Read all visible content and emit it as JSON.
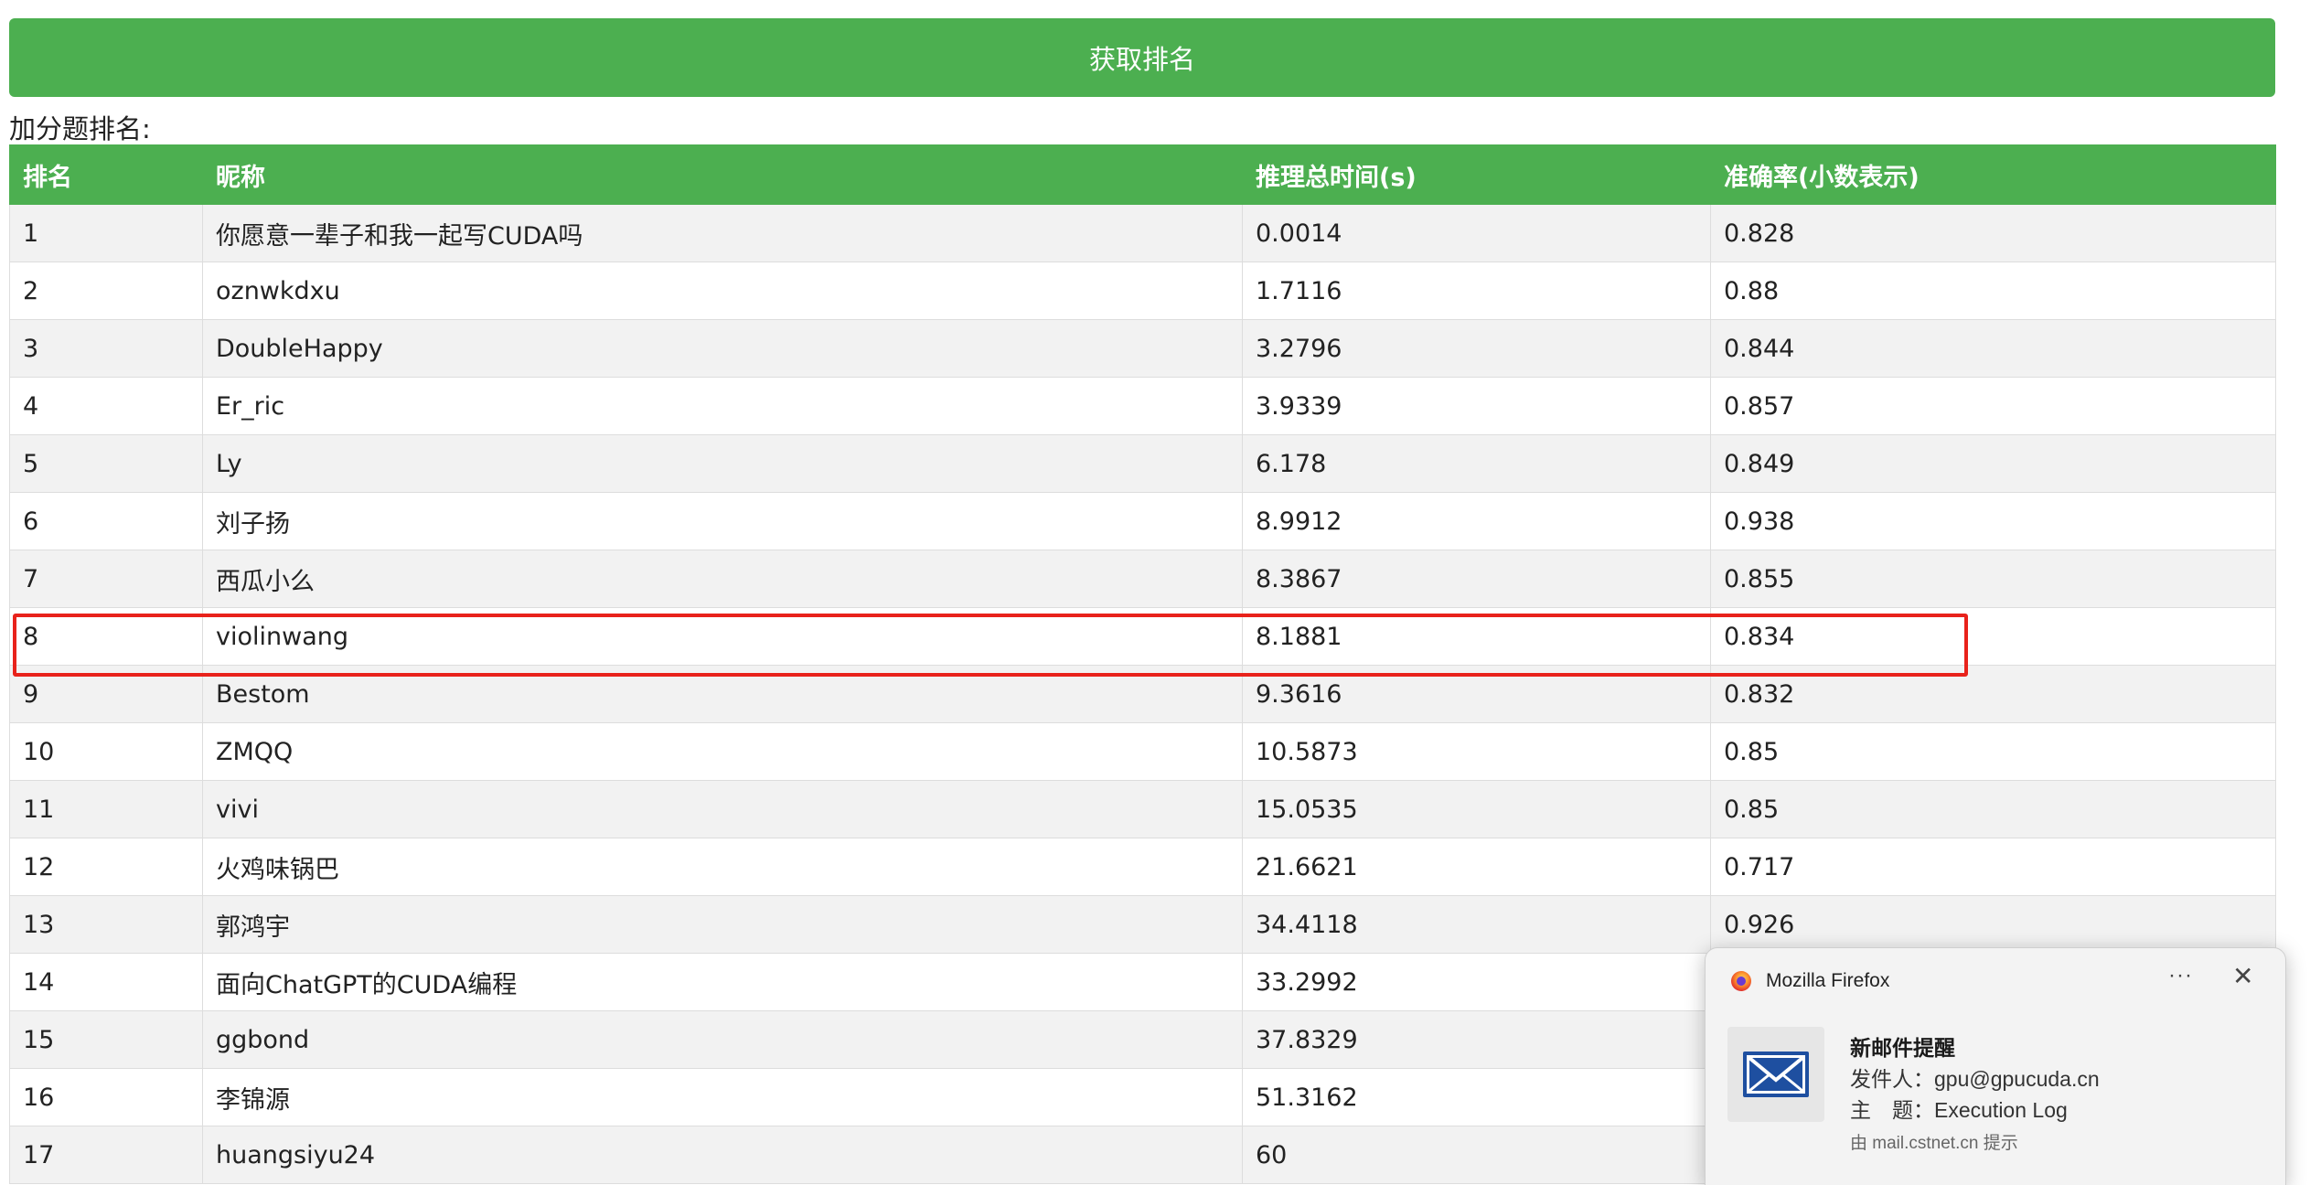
{
  "header": {
    "fetch_button_label": "获取排名"
  },
  "section_label": "加分题排名:",
  "table": {
    "headers": [
      "排名",
      "昵称",
      "推理总时间(s)",
      "准确率(小数表示)"
    ],
    "rows": [
      [
        "1",
        "你愿意一辈子和我一起写CUDA吗",
        "0.0014",
        "0.828"
      ],
      [
        "2",
        "oznwkdxu",
        "1.7116",
        "0.88"
      ],
      [
        "3",
        "DoubleHappy",
        "3.2796",
        "0.844"
      ],
      [
        "4",
        "Er_ric",
        "3.9339",
        "0.857"
      ],
      [
        "5",
        "Ly",
        "6.178",
        "0.849"
      ],
      [
        "6",
        "刘子扬",
        "8.9912",
        "0.938"
      ],
      [
        "7",
        "西瓜小么",
        "8.3867",
        "0.855"
      ],
      [
        "8",
        "violinwang",
        "8.1881",
        "0.834"
      ],
      [
        "9",
        "Bestom",
        "9.3616",
        "0.832"
      ],
      [
        "10",
        "ZMQQ",
        "10.5873",
        "0.85"
      ],
      [
        "11",
        "vivi",
        "15.0535",
        "0.85"
      ],
      [
        "12",
        "火鸡味锅巴",
        "21.6621",
        "0.717"
      ],
      [
        "13",
        "郭鸿宇",
        "34.4118",
        "0.926"
      ],
      [
        "14",
        "面向ChatGPT的CUDA编程",
        "33.2992",
        ""
      ],
      [
        "15",
        "ggbond",
        "37.8329",
        ""
      ],
      [
        "16",
        "李锦源",
        "51.3162",
        ""
      ],
      [
        "17",
        "huangsiyu24",
        "60",
        ""
      ]
    ]
  },
  "colors": {
    "accent_green": "#4caf50",
    "highlight_red": "#e8221b",
    "row_alt": "#f2f2f2"
  },
  "notification": {
    "app_name": "Mozilla Firefox",
    "app_icon": "firefox-icon",
    "more_glyph": "···",
    "close_glyph": "✕",
    "mail_icon": "envelope-icon",
    "title": "新邮件提醒",
    "sender_line": "发件人：gpu@gpucuda.cn",
    "subject_line": "主　题：Execution Log",
    "footer": "由 mail.cstnet.cn 提示"
  }
}
